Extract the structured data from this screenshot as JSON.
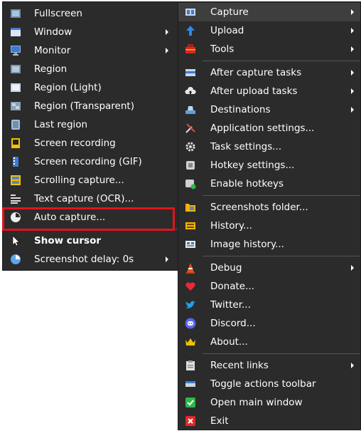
{
  "submenu": {
    "items": [
      {
        "label": "Fullscreen",
        "icon": "fullscreen-icon"
      },
      {
        "label": "Window",
        "icon": "window-icon",
        "submenu": true
      },
      {
        "label": "Monitor",
        "icon": "monitor-icon",
        "submenu": true
      },
      {
        "label": "Region",
        "icon": "region-icon"
      },
      {
        "label": "Region (Light)",
        "icon": "region-light-icon"
      },
      {
        "label": "Region (Transparent)",
        "icon": "region-transparent-icon"
      },
      {
        "label": "Last region",
        "icon": "last-region-icon"
      },
      {
        "label": "Screen recording",
        "icon": "screen-recording-icon"
      },
      {
        "label": "Screen recording (GIF)",
        "icon": "screen-recording-gif-icon"
      },
      {
        "label": "Scrolling capture...",
        "icon": "scrolling-capture-icon"
      },
      {
        "label": "Text capture (OCR)...",
        "icon": "text-capture-icon"
      },
      {
        "label": "Auto capture...",
        "icon": "auto-capture-icon",
        "highlighted": true
      },
      {
        "label": "Show cursor",
        "icon": "cursor-icon",
        "bold": true
      },
      {
        "label": "Screenshot delay: 0s",
        "icon": "clock-icon",
        "submenu": true
      }
    ]
  },
  "mainmenu": {
    "items": [
      {
        "label": "Capture",
        "icon": "capture-icon",
        "submenu": true,
        "active": true
      },
      {
        "label": "Upload",
        "icon": "upload-arrow-icon",
        "submenu": true
      },
      {
        "label": "Tools",
        "icon": "toolbox-icon",
        "submenu": true
      },
      {
        "label": "After capture tasks",
        "icon": "after-capture-icon",
        "submenu": true
      },
      {
        "label": "After upload tasks",
        "icon": "cloud-upload-icon",
        "submenu": true
      },
      {
        "label": "Destinations",
        "icon": "destinations-icon",
        "submenu": true
      },
      {
        "label": "Application settings...",
        "icon": "wrench-screwdriver-icon"
      },
      {
        "label": "Task settings...",
        "icon": "gear-icon"
      },
      {
        "label": "Hotkey settings...",
        "icon": "keyboard-icon"
      },
      {
        "label": "Enable hotkeys",
        "icon": "enable-hotkeys-icon"
      },
      {
        "label": "Screenshots folder...",
        "icon": "folder-icon"
      },
      {
        "label": "History...",
        "icon": "history-icon"
      },
      {
        "label": "Image history...",
        "icon": "image-history-icon"
      },
      {
        "label": "Debug",
        "icon": "debug-cone-icon",
        "submenu": true
      },
      {
        "label": "Donate...",
        "icon": "heart-icon"
      },
      {
        "label": "Twitter...",
        "icon": "twitter-bird-icon"
      },
      {
        "label": "Discord...",
        "icon": "discord-icon"
      },
      {
        "label": "About...",
        "icon": "crown-icon"
      },
      {
        "label": "Recent links",
        "icon": "clipboard-icon",
        "submenu": true
      },
      {
        "label": "Toggle actions toolbar",
        "icon": "toolbar-icon"
      },
      {
        "label": "Open main window",
        "icon": "checkmark-window-icon"
      },
      {
        "label": "Exit",
        "icon": "exit-x-icon"
      }
    ]
  },
  "colors": {
    "menu_background": "#2b2b2b",
    "text": "#ffffff",
    "highlight_box": "#e0141b"
  }
}
